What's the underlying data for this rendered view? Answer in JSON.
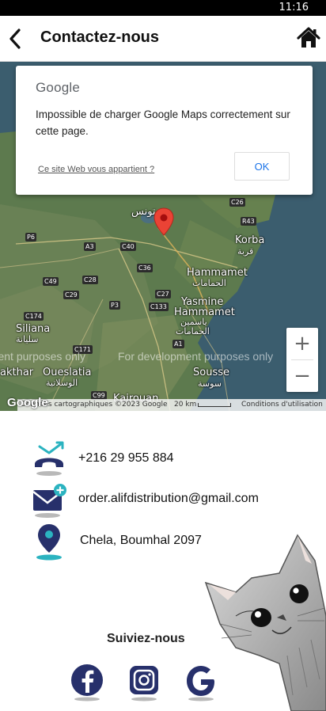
{
  "status_bar": {
    "time": "11:16"
  },
  "header": {
    "title": "Contactez-nous"
  },
  "map": {
    "error_dialog": {
      "logo": "Google",
      "message": "Impossible de charger Google Maps correctement sur cette page.",
      "owner_link": "Ce site Web vous appartient ?",
      "ok_label": "OK"
    },
    "dev_watermark": "For development purposes only",
    "labels": {
      "tunis_ar": "تونس",
      "korba": "Korba",
      "korba_ar": "قربة",
      "hammamet": "Hammamet",
      "hammamet_ar": "الحمامات",
      "yasmine": "Yasmine",
      "hammamet2": "Hammamet",
      "yasmine_ar": "ياسمين",
      "yasmine_ar2": "الحمامات",
      "siliana": "Siliana",
      "siliana_ar": "سليانة",
      "oueslatia": "Oueslatia",
      "oueslatia_ar": "الوسلاتية",
      "sousse": "Sousse",
      "sousse_ar": "سوسة",
      "makthar": "akthar",
      "kairouan": "Kairouan"
    },
    "roads": [
      "C26",
      "R43",
      "P6",
      "A3",
      "C40",
      "C36",
      "C49",
      "C28",
      "C29",
      "P3",
      "C133",
      "C27",
      "C174",
      "C171",
      "A1",
      "C99",
      "C171"
    ],
    "zoom_in": "+",
    "zoom_out": "−",
    "footer": {
      "logo": "Google",
      "data": "Données cartographiques ©2023 Google",
      "scale": "20 km",
      "terms": "Conditions d'utilisation"
    }
  },
  "contacts": {
    "phone": "+216 29 955 884",
    "email": "order.alifdistribution@gmail.com",
    "address": "Chela, Boumhal 2097"
  },
  "follow": {
    "title": "Suiviez-nous"
  },
  "colors": {
    "accent_navy": "#27306b",
    "accent_teal": "#2bb3c0",
    "map_water": "#3b5d6e",
    "map_land": "#5d7a4e"
  }
}
